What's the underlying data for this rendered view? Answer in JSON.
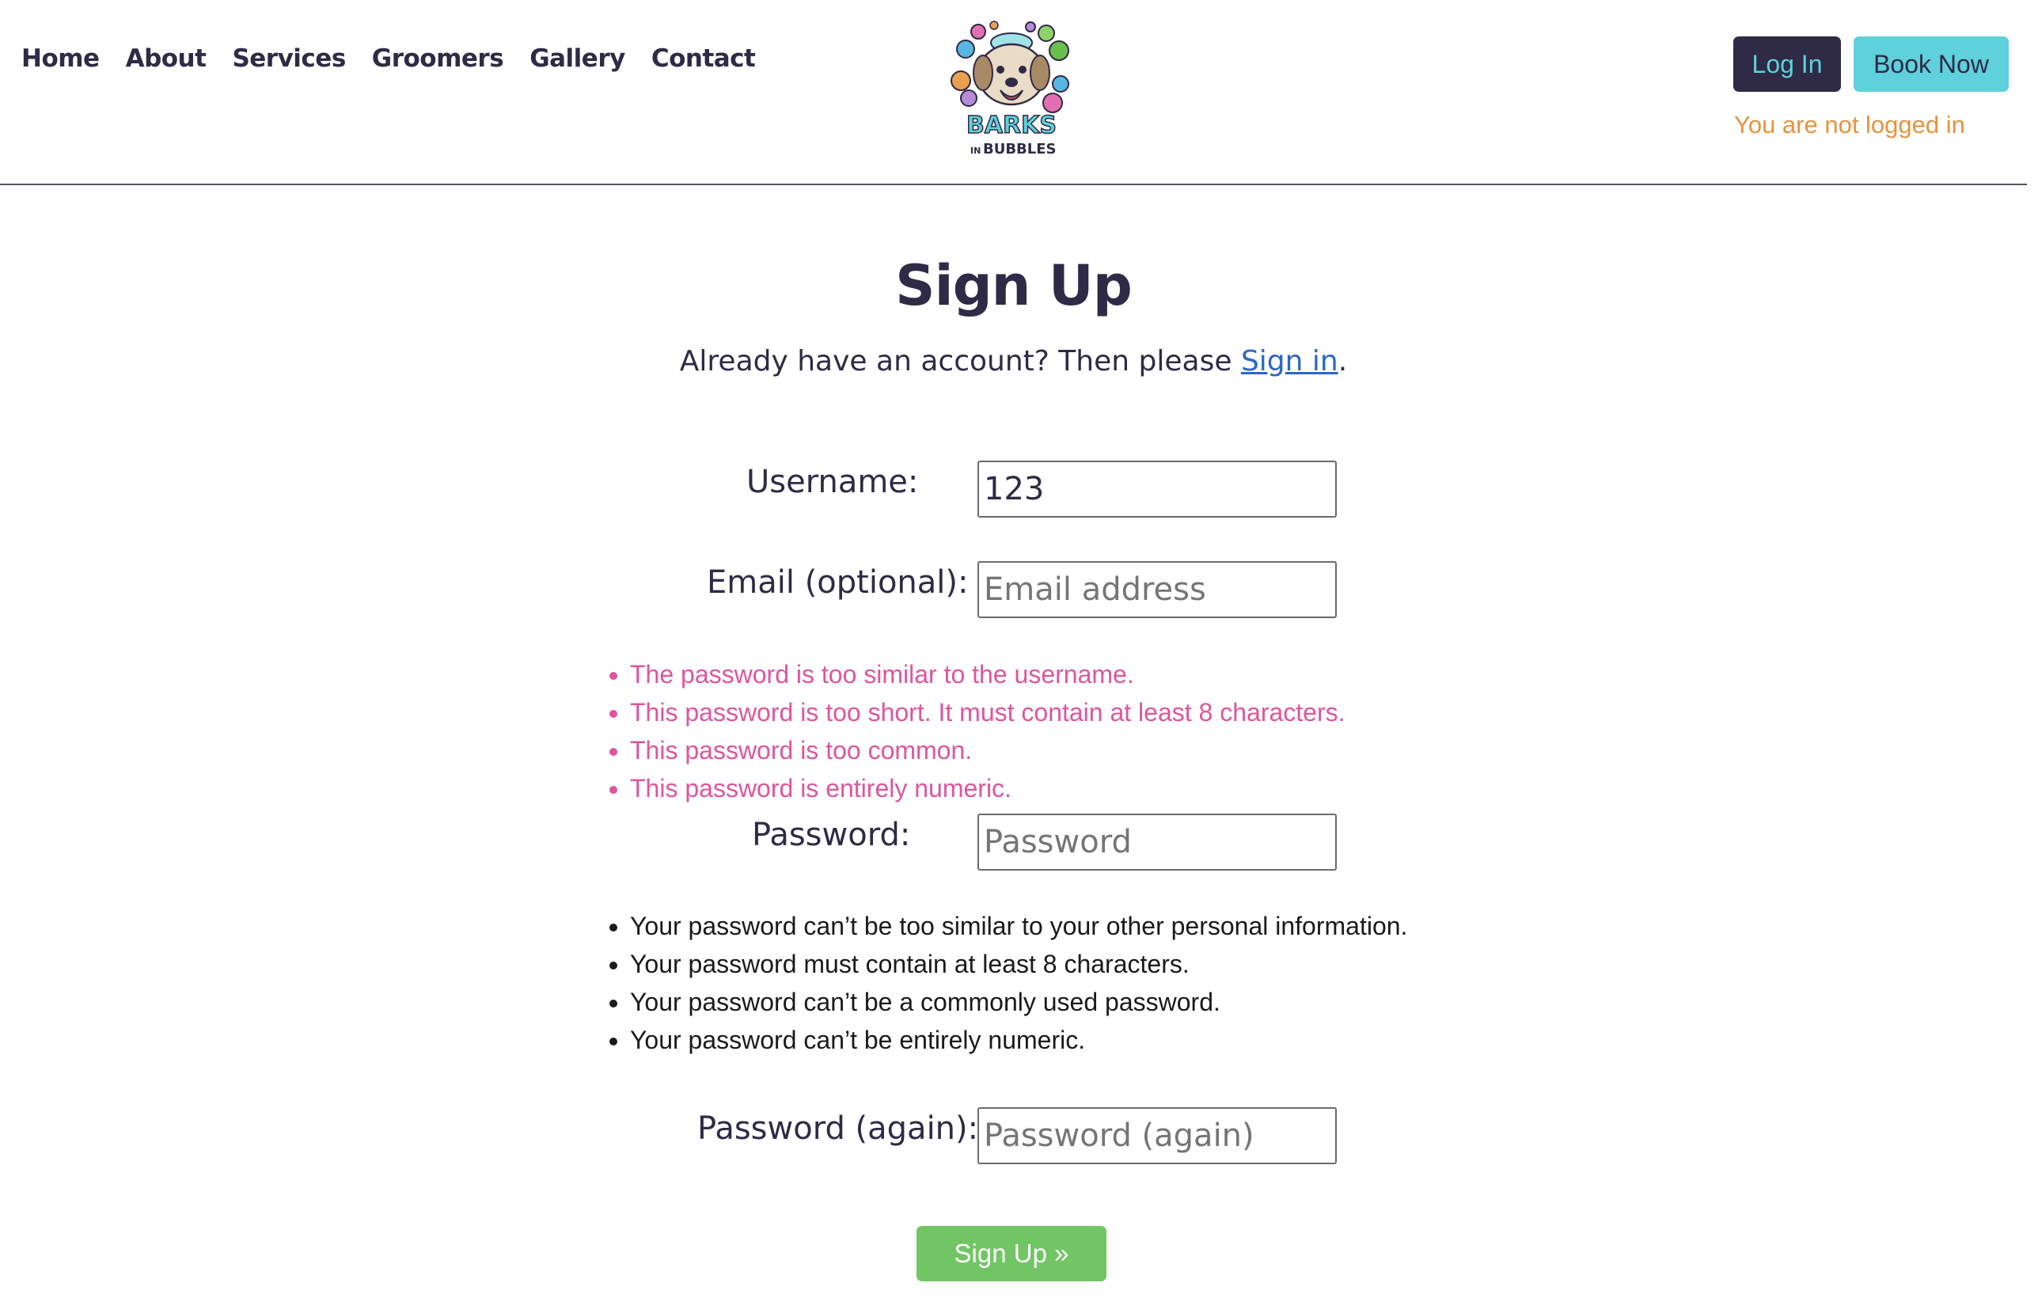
{
  "nav": {
    "items": [
      "Home",
      "About",
      "Services",
      "Groomers",
      "Gallery",
      "Contact"
    ]
  },
  "logo": {
    "name": "Barks in Bubbles",
    "line1": "BARKS",
    "line2_small": "IN",
    "line2": "BUBBLES"
  },
  "header": {
    "login_label": "Log In",
    "book_label": "Book Now",
    "status_text": "You are not logged in"
  },
  "main": {
    "title": "Sign Up",
    "subtitle_prefix": "Already have an account? Then please ",
    "signin_link": "Sign in",
    "subtitle_suffix": "."
  },
  "form": {
    "username_label": "Username:",
    "username_value": "123",
    "email_label": "Email (optional):",
    "email_placeholder": "Email address",
    "password_label": "Password:",
    "password_placeholder": "Password",
    "password2_label": "Password (again):",
    "password2_placeholder": "Password (again)",
    "errors": [
      "The password is too similar to the username.",
      "This password is too short. It must contain at least 8 characters.",
      "This password is too common.",
      "This password is entirely numeric."
    ],
    "help": [
      "Your password can’t be too similar to your other personal information.",
      "Your password must contain at least 8 characters.",
      "Your password can’t be a commonly used password.",
      "Your password can’t be entirely numeric."
    ],
    "submit_label": "Sign Up »"
  },
  "colors": {
    "primary_dark": "#2f2a45",
    "accent_cyan": "#5fd1dc",
    "error_pink": "#e0549e",
    "status_orange": "#e8923e",
    "submit_green": "#72c564",
    "link_blue": "#2c66c7"
  }
}
